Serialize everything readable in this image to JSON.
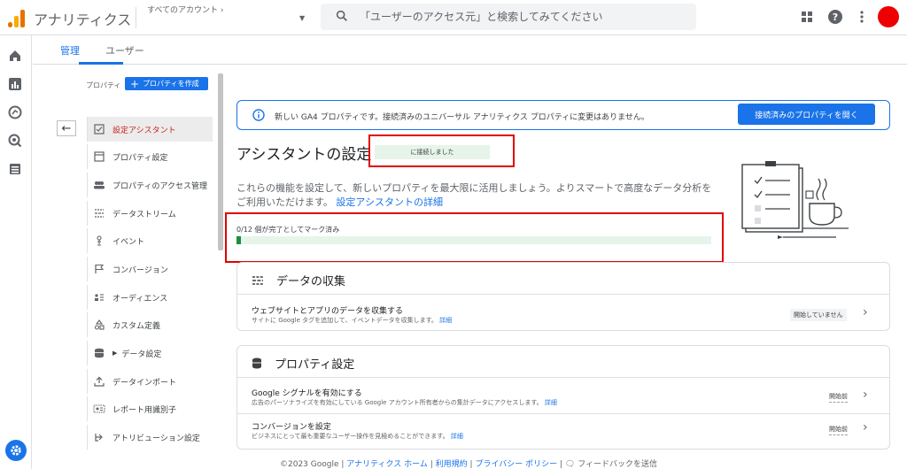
{
  "app": {
    "title": "アナリティクス",
    "account_label": "すべてのアカウント"
  },
  "search": {
    "placeholder": "「ユーザーのアクセス元」と検索してみてください"
  },
  "tabs": [
    {
      "label": "管理"
    },
    {
      "label": "ユーザー"
    }
  ],
  "sidebar": {
    "section_label": "プロパティ",
    "create_label": "プロパティを作成",
    "items": [
      {
        "label": "設定アシスタント"
      },
      {
        "label": "プロパティ設定"
      },
      {
        "label": "プロパティのアクセス管理"
      },
      {
        "label": "データストリーム"
      },
      {
        "label": "イベント"
      },
      {
        "label": "コンバージョン"
      },
      {
        "label": "オーディエンス"
      },
      {
        "label": "カスタム定義"
      },
      {
        "label": "データ設定"
      },
      {
        "label": "データインポート"
      },
      {
        "label": "レポート用識別子"
      },
      {
        "label": "アトリビューション設定"
      }
    ]
  },
  "banner": {
    "text": "新しい GA4 プロパティです。接続済みのユニバーサル アナリティクス プロパティに変更はありません。",
    "button_label": "接続済みのプロパティを開く"
  },
  "assistant": {
    "title": "アシスタントの設定",
    "connected_badge": "に接続しました",
    "description": "これらの機能を設定して、新しいプロパティを最大限に活用しましょう。よりスマートで高度なデータ分析をご利用いただけます。",
    "description_link": "設定アシスタントの詳細",
    "progress_label": "0/12 個が完了としてマーク済み",
    "progress_fraction": 0.01
  },
  "cards": {
    "data_collection": {
      "title": "データの収集",
      "rows": [
        {
          "title": "ウェブサイトとアプリのデータを収集する",
          "subtitle": "サイトに Google タグを追加して、イベントデータを収集します。",
          "link": "詳細",
          "status": "開始していません"
        }
      ]
    },
    "property_settings": {
      "title": "プロパティ設定",
      "rows": [
        {
          "title": "Google シグナルを有効にする",
          "subtitle": "広告のパーソナライズを有効にしている Google アカウント所有者からの集計データにアクセスします。",
          "link": "詳細",
          "status": "開始前"
        },
        {
          "title": "コンバージョンを設定",
          "subtitle": "ビジネスにとって最も重要なユーザー操作を見極めることができます。",
          "link": "詳細",
          "status": "開始前"
        }
      ]
    }
  },
  "footer": {
    "copyright": "©2023 Google |",
    "links": [
      "アナリティクス ホーム",
      "利用規約",
      "プライバシー ポリシー"
    ],
    "feedback": "フィードバックを送信"
  },
  "colors": {
    "accent": "#1a73e8",
    "progress": "#1e8e3e",
    "highlight": "#e00000",
    "avatar": "#ee0000"
  },
  "icons": [
    "analytics-logo-icon",
    "search-icon",
    "apps-grid-icon",
    "help-icon",
    "more-vert-icon",
    "home-icon",
    "reports-icon",
    "explore-icon",
    "advertising-icon",
    "library-icon",
    "admin-gear-icon"
  ]
}
